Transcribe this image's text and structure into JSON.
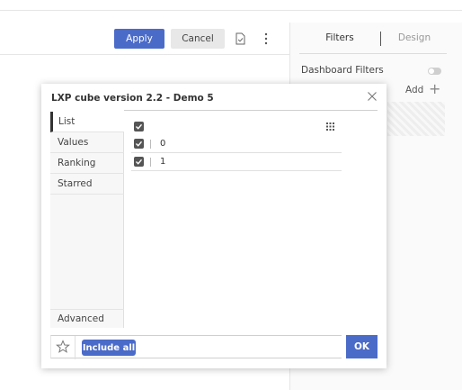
{
  "toolbar": {
    "apply_label": "Apply",
    "cancel_label": "Cancel",
    "doc_icon": "document-check-icon",
    "more_icon": "more-vertical-icon"
  },
  "right_panel": {
    "tabs": [
      {
        "label": "Filters",
        "active": true
      },
      {
        "label": "Design",
        "active": false
      }
    ],
    "dashboard_filters_label": "Dashboard Filters",
    "add_label": "Add"
  },
  "dialog": {
    "title": "LXP cube version 2.2 - Demo 5",
    "nav_items": [
      {
        "label": "List",
        "active": true
      },
      {
        "label": "Values",
        "active": false
      },
      {
        "label": "Ranking",
        "active": false
      },
      {
        "label": "Starred",
        "active": false
      }
    ],
    "advanced_label": "Advanced",
    "list": {
      "select_all_checked": true,
      "rows": [
        {
          "value": "0",
          "checked": true
        },
        {
          "value": "1",
          "checked": true
        }
      ]
    },
    "footer": {
      "include_all_label": "Include all",
      "ok_label": "OK"
    }
  },
  "colors": {
    "accent": "#4b6bc9",
    "checkbox": "#555555"
  }
}
